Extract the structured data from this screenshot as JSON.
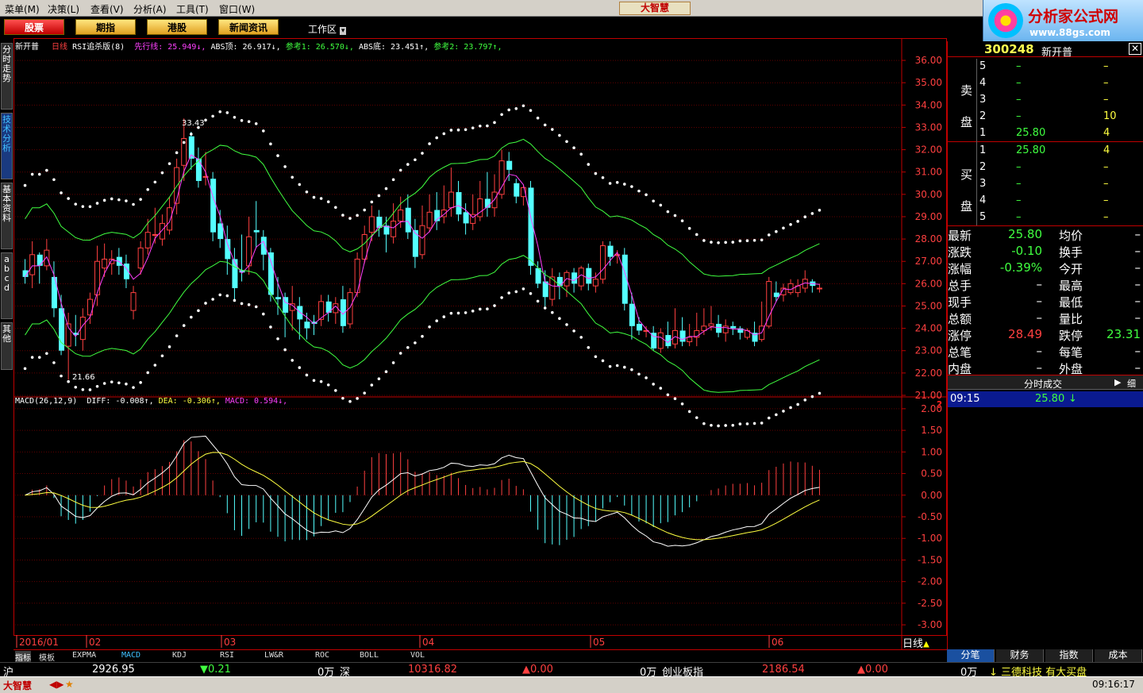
{
  "menu": [
    "菜单(M)",
    "决策(L)",
    "查看(V)",
    "分析(A)",
    "工具(T)",
    "窗口(W)"
  ],
  "app_logo": "大智慧",
  "brand": {
    "title": "分析家公式网",
    "url": "www.88gs.com"
  },
  "toolbar": {
    "buttons": [
      "股票",
      "期指",
      "港股",
      "新闻资讯"
    ],
    "workarea": "工作区"
  },
  "side_tabs": [
    "分时走势",
    "技术分析",
    "基本资料",
    "abcd",
    "其他"
  ],
  "main_indicator": {
    "stock": "新开普",
    "period": "日线",
    "name": "RSI追杀版(8)",
    "items": [
      {
        "label": "先行线:",
        "value": "25.949",
        "arrow": "↓",
        "color": "#ff40ff"
      },
      {
        "label": "ABS顶:",
        "value": "26.917",
        "arrow": "↓",
        "color": "#ffffff"
      },
      {
        "label": "参考1:",
        "value": "26.570",
        "arrow": "↓",
        "color": "#40ff40"
      },
      {
        "label": "ABS底:",
        "value": "23.451",
        "arrow": "↑",
        "color": "#ffffff"
      },
      {
        "label": "参考2:",
        "value": "23.797",
        "arrow": "↑",
        "color": "#40ff40"
      }
    ],
    "high_label": "33.43",
    "low_label": "21.66"
  },
  "macd_indicator": {
    "name": "MACD(26,12,9)",
    "items": [
      {
        "label": "DIFF:",
        "value": "-0.008",
        "arrow": "↑",
        "color": "#ffffff"
      },
      {
        "label": "DEA:",
        "value": "-0.306",
        "arrow": "↑",
        "color": "#ffff40"
      },
      {
        "label": "MACD:",
        "value": "0.594",
        "arrow": "↓",
        "color": "#ff40ff"
      }
    ]
  },
  "price_axis": [
    "36.00",
    "35.00",
    "34.00",
    "33.00",
    "32.00",
    "31.00",
    "30.00",
    "29.00",
    "28.00",
    "27.00",
    "26.00",
    "25.00",
    "24.00",
    "23.00",
    "22.00",
    "21.00"
  ],
  "macd_axis": [
    "2.00",
    "1.50",
    "1.00",
    "0.50",
    "0.00",
    "-0.50",
    "-1.00",
    "-1.50",
    "-2.00",
    "-2.50",
    "-3.00"
  ],
  "time_axis": [
    "2016/01",
    "02",
    "03",
    "04",
    "05",
    "06"
  ],
  "period_label": "日线",
  "chart_data": {
    "type": "candlestick",
    "title": "新开普 日线",
    "ylim": [
      21,
      36.5
    ],
    "macd_ylim": [
      -3.2,
      2.2
    ],
    "time_labels": [
      "2016/01",
      "02",
      "03",
      "04",
      "05",
      "06"
    ],
    "candles": [
      [
        26.6,
        26.3,
        27.1,
        26.0
      ],
      [
        26.4,
        27.3,
        27.9,
        25.8
      ],
      [
        27.3,
        26.8,
        27.4,
        26.0
      ],
      [
        26.8,
        27.5,
        28.0,
        26.6
      ],
      [
        26.3,
        24.9,
        27.0,
        24.5
      ],
      [
        24.9,
        23.0,
        25.5,
        22.8
      ],
      [
        23.2,
        24.2,
        24.7,
        21.7
      ],
      [
        23.8,
        23.7,
        24.6,
        23.2
      ],
      [
        23.5,
        24.5,
        24.9,
        23.0
      ],
      [
        24.6,
        25.3,
        25.6,
        24.2
      ],
      [
        25.5,
        27.0,
        27.7,
        25.0
      ],
      [
        26.7,
        27.1,
        27.8,
        26.3
      ],
      [
        26.9,
        27.1,
        27.5,
        26.4
      ],
      [
        27.2,
        26.8,
        27.6,
        26.4
      ],
      [
        26.9,
        26.2,
        27.3,
        25.8
      ],
      [
        24.8,
        25.6,
        25.9,
        24.4
      ],
      [
        26.7,
        27.6,
        27.9,
        26.4
      ],
      [
        27.6,
        28.3,
        28.9,
        27.3
      ],
      [
        28.2,
        28.2,
        29.4,
        27.8
      ],
      [
        28.0,
        28.7,
        29.1,
        27.7
      ],
      [
        28.4,
        29.4,
        29.9,
        28.2
      ],
      [
        29.6,
        31.2,
        31.6,
        29.1
      ],
      [
        31.3,
        32.5,
        33.4,
        30.6
      ],
      [
        32.6,
        31.6,
        32.8,
        31.1
      ],
      [
        31.6,
        30.6,
        32.1,
        30.3
      ],
      [
        30.8,
        30.8,
        31.9,
        30.4
      ],
      [
        30.7,
        28.3,
        31.0,
        27.9
      ],
      [
        28.7,
        28.0,
        29.3,
        27.6
      ],
      [
        28.0,
        27.1,
        28.6,
        26.4
      ],
      [
        27.1,
        25.8,
        27.6,
        25.3
      ],
      [
        26.6,
        26.5,
        28.2,
        26.1
      ],
      [
        26.8,
        28.1,
        29.0,
        26.4
      ],
      [
        28.4,
        28.3,
        29.7,
        27.6
      ],
      [
        28.1,
        27.3,
        28.4,
        26.6
      ],
      [
        27.4,
        25.5,
        27.6,
        25.2
      ],
      [
        25.4,
        25.3,
        26.3,
        24.6
      ],
      [
        25.4,
        24.7,
        25.6,
        23.6
      ],
      [
        24.8,
        25.1,
        25.9,
        23.9
      ],
      [
        25.0,
        24.4,
        25.4,
        23.5
      ],
      [
        24.3,
        24.0,
        24.7,
        23.5
      ],
      [
        24.3,
        24.2,
        24.6,
        23.7
      ],
      [
        24.4,
        25.2,
        25.5,
        24.1
      ],
      [
        25.2,
        24.7,
        25.5,
        24.3
      ],
      [
        24.7,
        25.1,
        25.4,
        24.2
      ],
      [
        25.3,
        24.1,
        25.9,
        23.8
      ],
      [
        24.2,
        25.6,
        25.8,
        24.0
      ],
      [
        25.6,
        27.1,
        27.4,
        25.4
      ],
      [
        27.1,
        28.2,
        28.6,
        26.9
      ],
      [
        28.3,
        29.0,
        29.5,
        27.9
      ],
      [
        29.0,
        28.5,
        29.3,
        28.1
      ],
      [
        28.6,
        28.2,
        29.0,
        27.4
      ],
      [
        28.1,
        28.8,
        29.6,
        27.8
      ],
      [
        28.8,
        29.3,
        29.9,
        28.5
      ],
      [
        29.4,
        28.3,
        30.0,
        28.0
      ],
      [
        28.4,
        27.2,
        28.9,
        26.7
      ],
      [
        27.3,
        28.6,
        29.5,
        27.1
      ],
      [
        28.5,
        29.2,
        30.0,
        28.3
      ],
      [
        29.3,
        28.8,
        30.1,
        28.4
      ],
      [
        29.0,
        29.3,
        30.4,
        28.7
      ],
      [
        29.4,
        30.1,
        31.2,
        29.0
      ],
      [
        30.1,
        29.1,
        30.6,
        28.8
      ],
      [
        29.2,
        28.7,
        29.6,
        28.2
      ],
      [
        28.7,
        29.1,
        30.0,
        28.4
      ],
      [
        29.0,
        29.8,
        30.6,
        28.8
      ],
      [
        29.8,
        29.4,
        31.0,
        29.0
      ],
      [
        29.4,
        30.1,
        30.9,
        29.0
      ],
      [
        30.0,
        31.5,
        32.0,
        29.8
      ],
      [
        31.5,
        31.1,
        31.9,
        30.6
      ],
      [
        30.5,
        29.9,
        30.7,
        29.6
      ],
      [
        29.9,
        30.3,
        30.4,
        29.5
      ],
      [
        30.3,
        26.8,
        30.6,
        26.4
      ],
      [
        26.7,
        26.0,
        27.0,
        25.8
      ],
      [
        26.1,
        25.4,
        26.6,
        24.9
      ],
      [
        25.3,
        26.3,
        26.7,
        25.0
      ],
      [
        26.3,
        25.9,
        26.5,
        25.3
      ],
      [
        25.9,
        26.5,
        26.6,
        25.4
      ],
      [
        26.5,
        26.0,
        26.7,
        25.6
      ],
      [
        25.9,
        26.7,
        26.8,
        25.7
      ],
      [
        26.7,
        26.0,
        26.9,
        25.7
      ],
      [
        25.9,
        26.2,
        26.5,
        25.6
      ],
      [
        26.2,
        27.7,
        27.9,
        26.0
      ],
      [
        27.7,
        27.2,
        27.9,
        26.8
      ],
      [
        27.3,
        27.3,
        27.5,
        26.9
      ],
      [
        27.3,
        25.1,
        27.6,
        24.8
      ],
      [
        25.1,
        24.1,
        25.6,
        23.5
      ],
      [
        24.2,
        23.9,
        24.5,
        23.7
      ],
      [
        23.9,
        23.9,
        24.1,
        23.6
      ],
      [
        23.8,
        23.1,
        24.1,
        23.0
      ],
      [
        23.1,
        23.8,
        24.0,
        22.9
      ],
      [
        23.7,
        23.2,
        24.3,
        23.1
      ],
      [
        23.3,
        23.9,
        24.9,
        23.1
      ],
      [
        23.9,
        23.4,
        24.5,
        23.2
      ],
      [
        23.4,
        23.6,
        24.2,
        23.2
      ],
      [
        23.6,
        23.9,
        24.7,
        23.2
      ],
      [
        23.9,
        24.1,
        24.9,
        23.7
      ],
      [
        24.1,
        24.2,
        25.0,
        23.9
      ],
      [
        24.2,
        23.8,
        24.6,
        23.6
      ],
      [
        23.8,
        24.1,
        24.4,
        23.4
      ],
      [
        24.1,
        24.0,
        24.3,
        23.7
      ],
      [
        24.0,
        23.8,
        24.1,
        23.5
      ],
      [
        23.6,
        23.9,
        24.0,
        23.5
      ],
      [
        23.8,
        23.4,
        24.3,
        23.2
      ],
      [
        23.5,
        24.1,
        25.2,
        23.4
      ],
      [
        24.1,
        26.1,
        26.3,
        24.0
      ],
      [
        25.6,
        25.4,
        26.1,
        25.2
      ],
      [
        25.5,
        25.8,
        26.0,
        25.2
      ],
      [
        25.6,
        26.0,
        26.2,
        25.5
      ],
      [
        25.6,
        25.9,
        26.2,
        25.4
      ],
      [
        25.8,
        26.2,
        26.6,
        25.6
      ],
      [
        26.1,
        25.9,
        26.2,
        25.6
      ],
      [
        25.8,
        25.8,
        26.0,
        25.6
      ]
    ],
    "series": [
      {
        "name": "先行线",
        "color": "#ff40ff",
        "values": []
      },
      {
        "name": "参考1",
        "color": "#40ff40",
        "values": []
      },
      {
        "name": "参考2",
        "color": "#40ff40",
        "values": []
      }
    ]
  },
  "quote": {
    "code": "300248",
    "name": "新开普",
    "sell_label": [
      "卖",
      "盘"
    ],
    "buy_label": [
      "买",
      "盘"
    ],
    "asks": [
      [
        "5",
        "–",
        "–"
      ],
      [
        "4",
        "–",
        "–"
      ],
      [
        "3",
        "–",
        "–"
      ],
      [
        "2",
        "–",
        "10"
      ],
      [
        "1",
        "25.80",
        "4"
      ]
    ],
    "bids": [
      [
        "1",
        "25.80",
        "4"
      ],
      [
        "2",
        "–",
        "–"
      ],
      [
        "3",
        "–",
        "–"
      ],
      [
        "4",
        "–",
        "–"
      ],
      [
        "5",
        "–",
        "–"
      ]
    ],
    "stats": [
      [
        "最新",
        "25.80",
        "均价",
        "–"
      ],
      [
        "涨跌",
        "-0.10",
        "换手",
        "–"
      ],
      [
        "涨幅",
        "-0.39%",
        "今开",
        "–"
      ],
      [
        "总手",
        "–",
        "最高",
        "–"
      ],
      [
        "现手",
        "–",
        "最低",
        "–"
      ],
      [
        "总额",
        "–",
        "量比",
        "–"
      ],
      [
        "涨停",
        "28.49",
        "跌停",
        "23.31"
      ],
      [
        "总笔",
        "–",
        "每笔",
        "–"
      ],
      [
        "内盘",
        "–",
        "外盘",
        "–"
      ]
    ],
    "tick_header": "分时成交",
    "tick_btn": "细",
    "tick": {
      "time": "09:15",
      "price": "25.80",
      "arrow": "↓"
    }
  },
  "bottom_tabs": [
    "指标",
    "模板",
    "EXPMA",
    "MACD",
    "KDJ",
    "RSI",
    "LW&R",
    "ROC",
    "BOLL",
    "VOL"
  ],
  "right_tabs": [
    "分笔",
    "财务",
    "指数",
    "成本"
  ],
  "status": {
    "sh_label": "沪",
    "sh_index": "2926.95",
    "sh_change": "▼0.21",
    "sh_vol": "0万",
    "sz_label": "深",
    "sz_index": "10316.82",
    "sz_change": "▲0.00",
    "sz_vol": "0万",
    "cy_label": "创业板指",
    "cy_index": "2186.54",
    "cy_change": "▲0.00",
    "cy_vol": "0万",
    "news": "↓ 三德科技 有大买盘"
  },
  "taskbar": {
    "app": "大智慧",
    "clock": "09:16:17"
  }
}
